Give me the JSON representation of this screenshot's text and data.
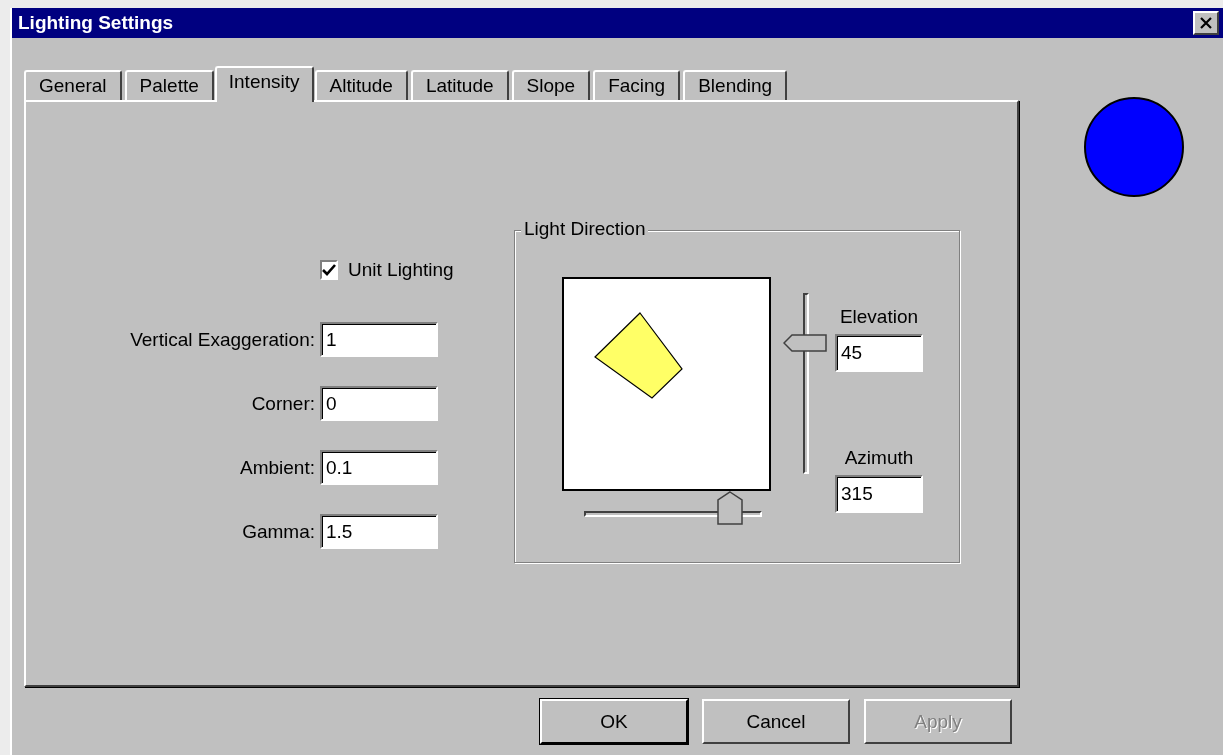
{
  "window": {
    "title": "Lighting Settings"
  },
  "tabs": [
    {
      "label": "General",
      "selected": false
    },
    {
      "label": "Palette",
      "selected": false
    },
    {
      "label": "Intensity",
      "selected": true
    },
    {
      "label": "Altitude",
      "selected": false
    },
    {
      "label": "Latitude",
      "selected": false
    },
    {
      "label": "Slope",
      "selected": false
    },
    {
      "label": "Facing",
      "selected": false
    },
    {
      "label": "Blending",
      "selected": false
    }
  ],
  "unit_lighting": {
    "label": "Unit Lighting",
    "checked": true
  },
  "fields": [
    {
      "label": "Vertical Exaggeration:",
      "value": "1"
    },
    {
      "label": "Corner:",
      "value": "0"
    },
    {
      "label": "Ambient:",
      "value": "0.1"
    },
    {
      "label": "Gamma:",
      "value": "1.5"
    }
  ],
  "light_direction": {
    "title": "Light Direction",
    "elevation_slider": {
      "level": 0.73
    },
    "azimuth_slider": {
      "level": 0.83
    },
    "elevation": {
      "label": "Elevation",
      "value": "45"
    },
    "azimuth": {
      "label": "Azimuth",
      "value": "315"
    }
  },
  "buttons": [
    {
      "label": "OK",
      "default": true,
      "disabled": false
    },
    {
      "label": "Cancel",
      "default": false,
      "disabled": false
    },
    {
      "label": "Apply",
      "default": false,
      "disabled": true
    }
  ],
  "color_swatch": {
    "color": "#0000ff"
  }
}
